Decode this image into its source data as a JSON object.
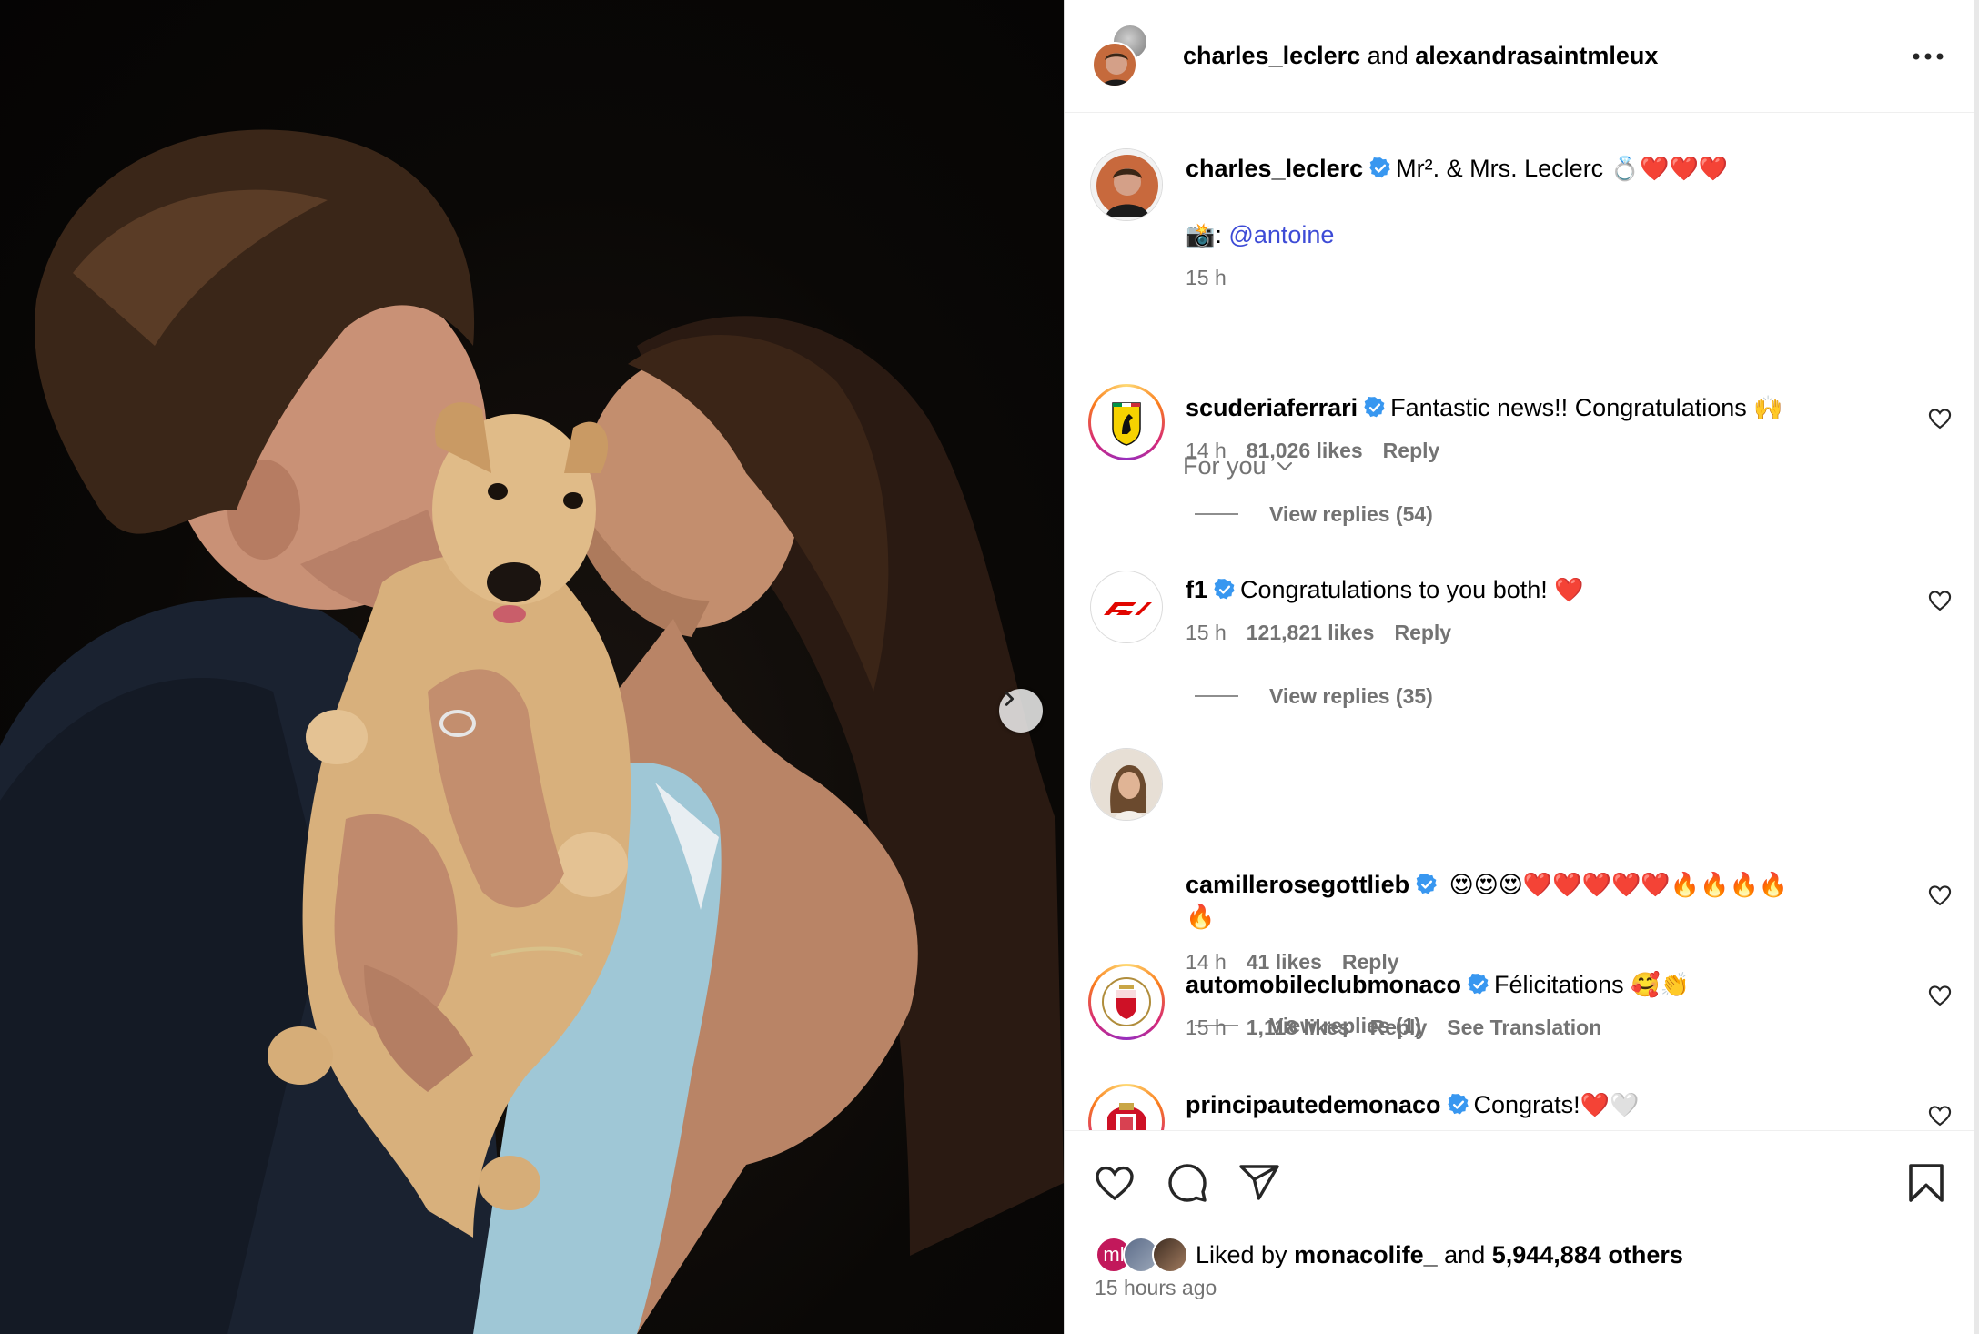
{
  "header": {
    "user1": "charles_leclerc",
    "conj": "and",
    "user2": "alexandrasaintmleux",
    "more_icon": "more-horizontal-icon"
  },
  "caption": {
    "username": "charles_leclerc",
    "text": "Mr². & Mrs. Leclerc",
    "emojis": "💍❤️❤️❤️",
    "credit_emoji": "📸",
    "credit_sep": ":",
    "credit_mention": "@antoine",
    "time": "15 h"
  },
  "for_you": {
    "label": "For you",
    "icon": "chevron-down-icon"
  },
  "comments": [
    {
      "username": "scuderiaferrari",
      "text": "Fantastic news!! Congratulations",
      "emojis": "🙌",
      "time": "14 h",
      "likes": "81,026 likes",
      "reply": "Reply",
      "view_replies": "View replies (54)"
    },
    {
      "username": "f1",
      "text": "Congratulations to you both!",
      "emojis": "❤️",
      "time": "15 h",
      "likes": "121,821 likes",
      "reply": "Reply",
      "view_replies": "View replies (35)"
    },
    {
      "username": "camillerosegottlieb",
      "text": "",
      "emojis": "😍😍😍❤️❤️❤️❤️❤️🔥🔥🔥🔥",
      "emojis_line2": "🔥",
      "time": "14 h",
      "likes": "41 likes",
      "reply": "Reply",
      "view_replies": "View replies (1)"
    },
    {
      "username": "automobileclubmonaco",
      "text": "Félicitations",
      "emojis": "🥰👏",
      "time": "15 h",
      "likes": "1,118 likes",
      "reply": "Reply",
      "translation": "See Translation"
    },
    {
      "username": "principautedemonaco",
      "text": "Congrats!",
      "emojis": "❤️🤍"
    }
  ],
  "actions": {
    "like_icon": "heart-icon",
    "comment_icon": "comment-icon",
    "share_icon": "send-icon",
    "save_icon": "bookmark-icon"
  },
  "likes": {
    "prefix": "Liked by",
    "user": "monacolife_",
    "conj": "and",
    "count": "5,944,884 others",
    "mini_avatar_text": "ml"
  },
  "time_ago": "15 hours ago",
  "colors": {
    "accent_link": "#3d4bd6",
    "verified": "#3897f0",
    "muted": "#737373"
  }
}
